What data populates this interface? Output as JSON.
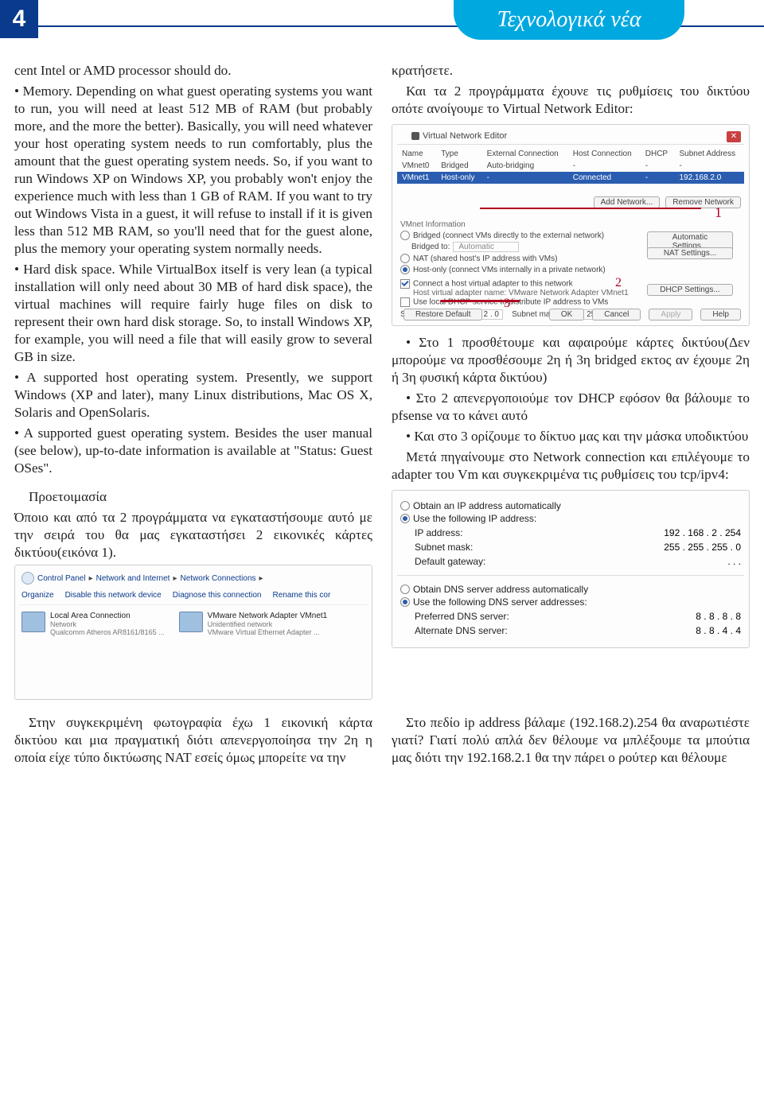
{
  "header": {
    "page_num": "4",
    "banner_a": "Τεχνο",
    "banner_b": "λογικά νέα"
  },
  "left": {
    "p1": "cent Intel or AMD processor should do.",
    "p2": "• Memory. Depending on what guest operating systems you want to run, you will need at least 512 MB of RAM (but probably more, and the more the better). Basically, you will need whatever your host operating system needs to run comfortably, plus the amount that the guest operating system needs. So, if you want to run Windows XP on Windows XP, you probably won't enjoy the experience much with less than 1 GB of RAM. If you want to try out Windows Vista in a guest, it will refuse to install if it is given less than 512 MB RAM, so you'll need that for the guest alone, plus the memory your operating system normally needs.",
    "p3": "• Hard disk space. While VirtualBox itself is very lean (a typical installation will only need about 30 MB of hard disk space), the virtual machines will require fairly huge files on disk to represent their own hard disk storage. So, to install Windows XP, for example, you will need a file that will easily grow to several GB in size.",
    "p4": "• A supported host operating system. Presently, we support Windows (XP and later), many Linux distributions, Mac OS X, Solaris and OpenSolaris.",
    "p5": "• A supported guest operating system. Besides the user manual (see below), up-to-date information is available at \"Status: Guest OSes\".",
    "p6": "Προετοιμασία",
    "p7": "Όποιο και από τα 2 προγράμματα να εγκαταστήσουμε αυτό με την σειρά του θα μας εγκαταστήσει 2 εικονικές κάρτες δικτύου(εικόνα 1).",
    "p8": "Στην συγκεκριμένη φωτογραφία έχω 1 εικονική κάρτα δικτύου και μια πραγματική διότι απενεργοποίησα την 2η η οποία είχε τύπο δικτύωσης NAT εσείς όμως μπορείτε να την"
  },
  "right": {
    "p1": "κρατήσετε.",
    "p2": "Και τα 2 προγράμματα έχουνε τις ρυθμίσεις του δικτύου οπότε ανοίγουμε το Virtual Network Editor:",
    "p3": "• Στο 1 προσθέτουμε και αφαιρούμε κάρτες δικτύου(Δεν μπορούμε να προσθέσουμε 2η ή 3η bridged εκτος αν έχουμε 2η ή 3η φυσική κάρτα δικτύου)",
    "p4": "• Στο 2 απενεργοποιούμε τον DHCP εφόσον θα βάλουμε το pfsense να το κάνει αυτό",
    "p5": "• Και στο 3 ορίζουμε το δίκτυο μας και την μάσκα υποδικτύου",
    "p6": "Μετά πηγαίνουμε στο Network connection και επιλέγουμε το adapter του Vm και συγκεκριμένα τις ρυθμίσεις του tcp/ipv4:",
    "p7": "Στο πεδίο ip address βάλαμε (192.168.2).254 θα αναρωτιέστε γιατί? Γιατί πολύ απλά δεν θέλουμε να μπλέξουμε τα μπούτια μας διότι την 192.168.2.1 θα την πάρει ο ρούτερ και θέλουμε"
  },
  "vne": {
    "title": "Virtual Network Editor",
    "cols": [
      "Name",
      "Type",
      "External Connection",
      "Host Connection",
      "DHCP",
      "Subnet Address"
    ],
    "rows": [
      {
        "name": "VMnet0",
        "type": "Bridged",
        "ext": "Auto-bridging",
        "host": "-",
        "dhcp": "-",
        "sub": "-"
      },
      {
        "name": "VMnet1",
        "type": "Host-only",
        "ext": "-",
        "host": "Connected",
        "dhcp": "-",
        "sub": "192.168.2.0",
        "hl": true
      }
    ],
    "btn_add": "Add Network...",
    "btn_rem": "Remove Network",
    "info": "VMnet Information",
    "r1": "Bridged (connect VMs directly to the external network)",
    "bridged_to": "Bridged to:",
    "bridged_v": "Automatic",
    "auto_btn": "Automatic Settings...",
    "r2": "NAT (shared host's IP address with VMs)",
    "nat_btn": "NAT Settings...",
    "r3": "Host-only (connect VMs internally in a private network)",
    "c1": "Connect a host virtual adapter to this network",
    "c1b": "Host virtual adapter name: VMware Network Adapter VMnet1",
    "c2": "Use local DHCP service to distribute IP address to VMs",
    "dhcp_btn": "DHCP Settings...",
    "sub_ip_l": "Subnet IP:",
    "sub_ip_v": "192 . 168 .   2 .   0",
    "mask_l": "Subnet mask:",
    "mask_v": "255 . 255 . 255 .  0",
    "restore": "Restore Default",
    "ok": "OK",
    "cancel": "Cancel",
    "apply": "Apply",
    "help": "Help",
    "n1": "1",
    "n2": "2",
    "n3": "3"
  },
  "ip": {
    "r1": "Obtain an IP address automatically",
    "r2": "Use the following IP address:",
    "ip_l": "IP address:",
    "ip_v": "192 . 168 .   2 . 254",
    "mask_l": "Subnet mask:",
    "mask_v": "255 . 255 . 255 .   0",
    "gw_l": "Default gateway:",
    "gw_v": ".       .       .",
    "r3": "Obtain DNS server address automatically",
    "r4": "Use the following DNS server addresses:",
    "pdns_l": "Preferred DNS server:",
    "pdns_v": "8 .   8 .   8 .   8",
    "adns_l": "Alternate DNS server:",
    "adns_v": "8 .   8 .   4 .   4"
  },
  "net": {
    "crumbs": [
      "Control Panel",
      "Network and Internet",
      "Network Connections"
    ],
    "toolbar": [
      "Organize",
      "Disable this network device",
      "Diagnose this connection",
      "Rename this cor"
    ],
    "item1": {
      "t": "Local Area Connection",
      "s1": "Network",
      "s2": "Qualcomm Atheros AR8161/8165 ..."
    },
    "item2": {
      "t": "VMware Network Adapter VMnet1",
      "s1": "Unidentified network",
      "s2": "VMware Virtual Ethernet Adapter ..."
    }
  }
}
